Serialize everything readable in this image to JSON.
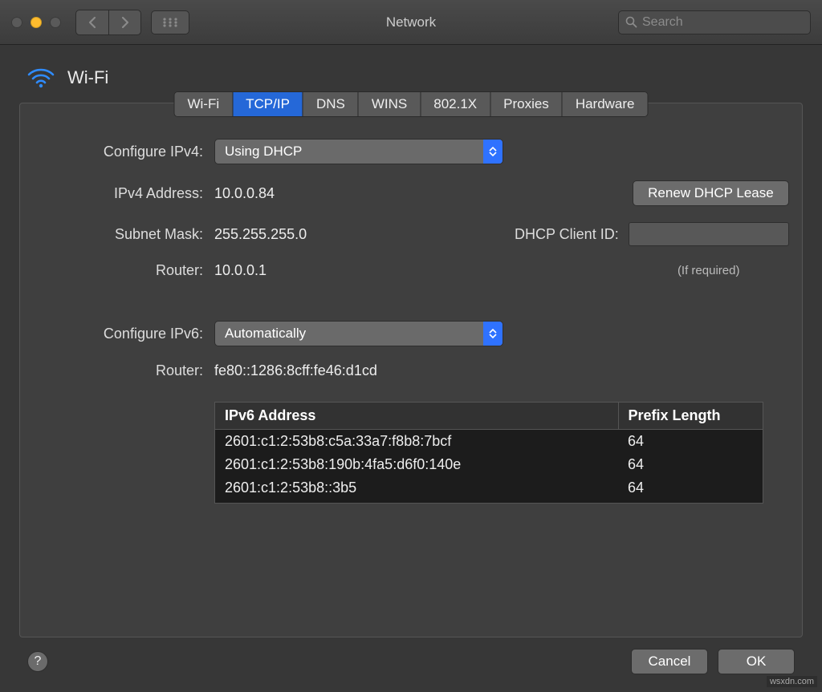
{
  "window": {
    "title": "Network",
    "search_placeholder": "Search"
  },
  "heading": {
    "title": "Wi-Fi"
  },
  "tabs": [
    "Wi-Fi",
    "TCP/IP",
    "DNS",
    "WINS",
    "802.1X",
    "Proxies",
    "Hardware"
  ],
  "active_tab_index": 1,
  "ipv4": {
    "configure_label": "Configure IPv4:",
    "configure_value": "Using DHCP",
    "address_label": "IPv4 Address:",
    "address_value": "10.0.0.84",
    "subnet_label": "Subnet Mask:",
    "subnet_value": "255.255.255.0",
    "router_label": "Router:",
    "router_value": "10.0.0.1",
    "renew_label": "Renew DHCP Lease",
    "client_id_label": "DHCP Client ID:",
    "client_id_value": "",
    "required_note": "(If required)"
  },
  "ipv6": {
    "configure_label": "Configure IPv6:",
    "configure_value": "Automatically",
    "router_label": "Router:",
    "router_value": "fe80::1286:8cff:fe46:d1cd",
    "table": {
      "headers": [
        "IPv6 Address",
        "Prefix Length"
      ],
      "rows": [
        {
          "address": "2601:c1:2:53b8:c5a:33a7:f8b8:7bcf",
          "prefix": "64"
        },
        {
          "address": "2601:c1:2:53b8:190b:4fa5:d6f0:140e",
          "prefix": "64"
        },
        {
          "address": "2601:c1:2:53b8::3b5",
          "prefix": "64"
        }
      ]
    }
  },
  "footer": {
    "cancel": "Cancel",
    "ok": "OK"
  },
  "watermark": "wsxdn.com"
}
